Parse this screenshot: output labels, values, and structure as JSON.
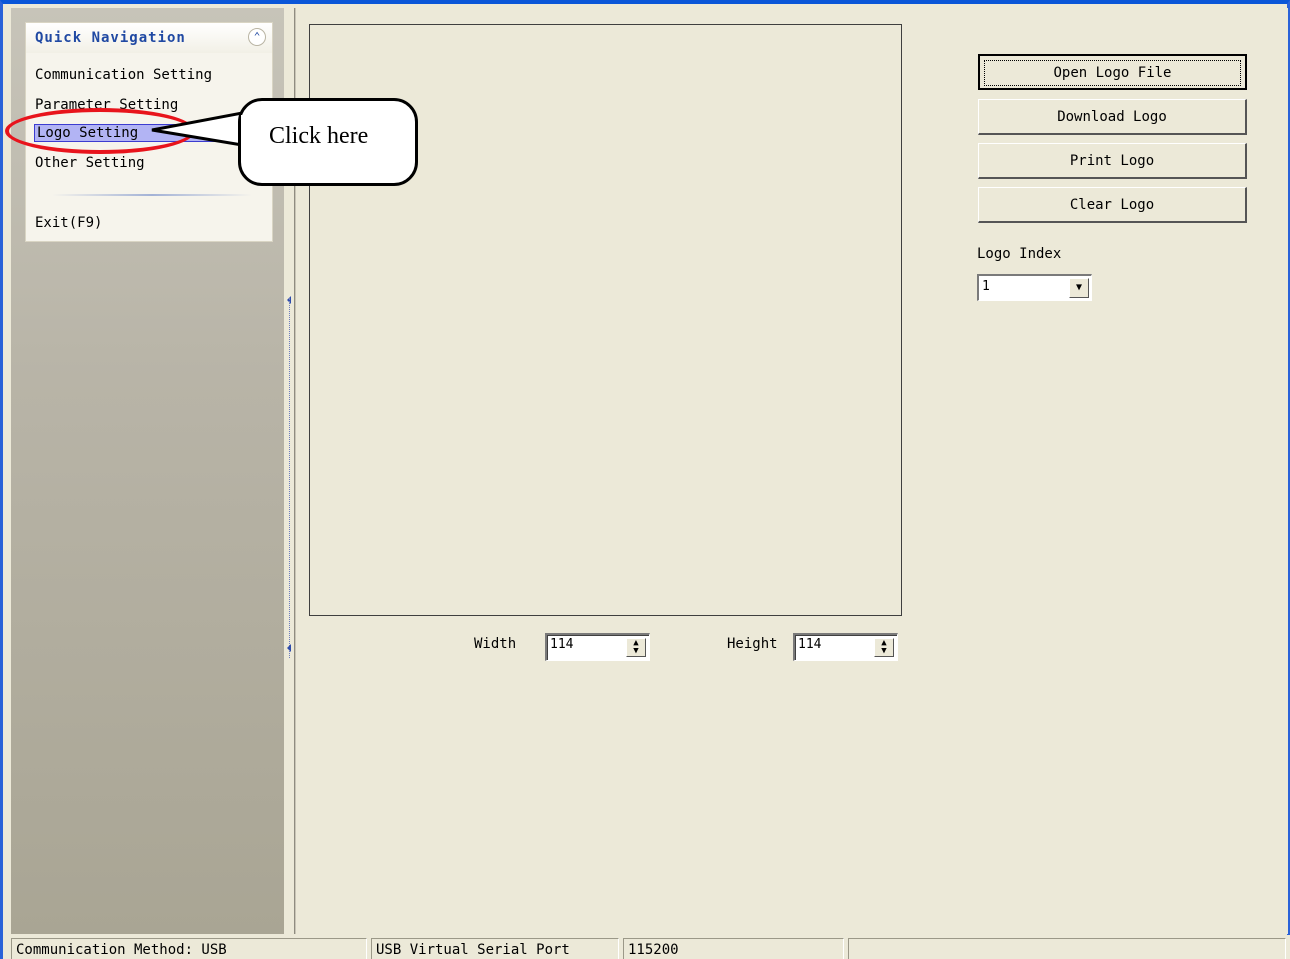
{
  "sidebar": {
    "title": "Quick Navigation",
    "collapse_icon": "double-chevron-up-icon",
    "items": [
      {
        "label": "Communication Setting"
      },
      {
        "label": "Parameter Setting"
      },
      {
        "label": "Logo Setting",
        "selected": true
      },
      {
        "label": "Other Setting"
      }
    ],
    "exit_label": "Exit(F9)"
  },
  "logo_panel": {
    "width_label": "Width",
    "width_value": "114",
    "height_label": "Height",
    "height_value": "114",
    "buttons": {
      "open": "Open Logo File",
      "download": "Download Logo",
      "print": "Print Logo",
      "clear": "Clear Logo"
    },
    "index_label": "Logo Index",
    "index_value": "1"
  },
  "status_bar": {
    "method": "Communication Method: USB",
    "port": "USB Virtual Serial Port",
    "baud": "115200",
    "extra": ""
  },
  "annotation": {
    "callout_text": "Click here",
    "highlight_color": "#e8141c"
  },
  "colors": {
    "window_border": "#0a56d8",
    "panel_bg": "#ece9d8",
    "nav_title": "#2049a3",
    "selection": "#b2b4f4"
  }
}
